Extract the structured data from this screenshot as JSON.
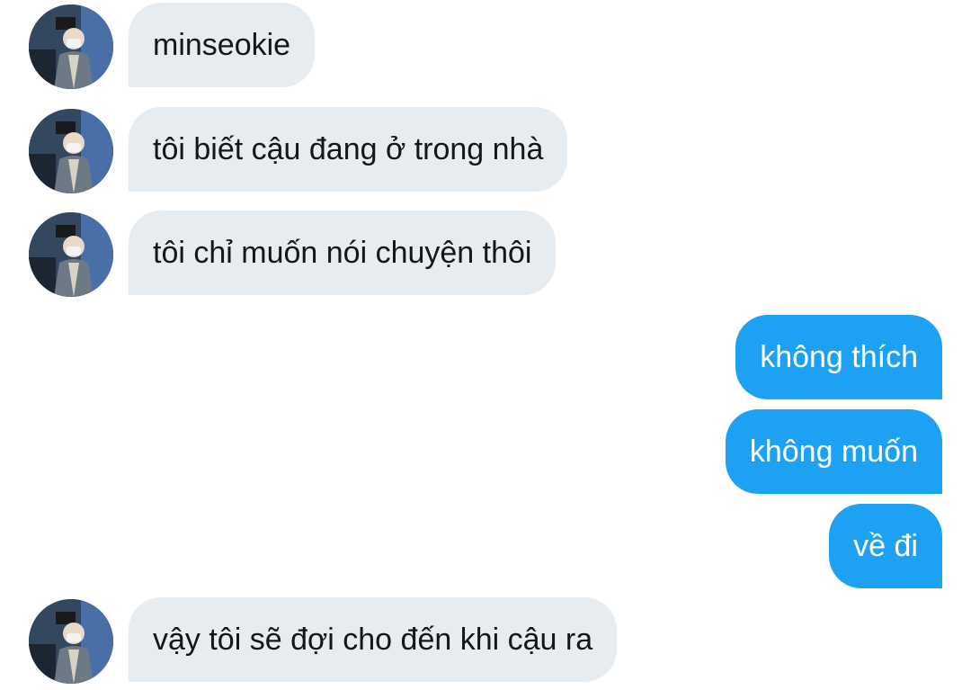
{
  "colors": {
    "incoming_bubble": "#e6ecf0",
    "incoming_text": "#14171a",
    "outgoing_bubble": "#1da1f2",
    "outgoing_text": "#ffffff",
    "background": "#ffffff"
  },
  "messages": [
    {
      "direction": "incoming",
      "text": "minseokie",
      "avatar": "user-avatar"
    },
    {
      "direction": "incoming",
      "text": "tôi biết cậu đang ở trong nhà",
      "avatar": "user-avatar"
    },
    {
      "direction": "incoming",
      "text": "tôi chỉ muốn nói chuyện thôi",
      "avatar": "user-avatar"
    },
    {
      "direction": "outgoing",
      "text": "không thích"
    },
    {
      "direction": "outgoing",
      "text": "không muốn"
    },
    {
      "direction": "outgoing",
      "text": "về đi"
    },
    {
      "direction": "incoming",
      "text": "vậy tôi sẽ đợi cho đến khi cậu ra",
      "avatar": "user-avatar"
    }
  ]
}
